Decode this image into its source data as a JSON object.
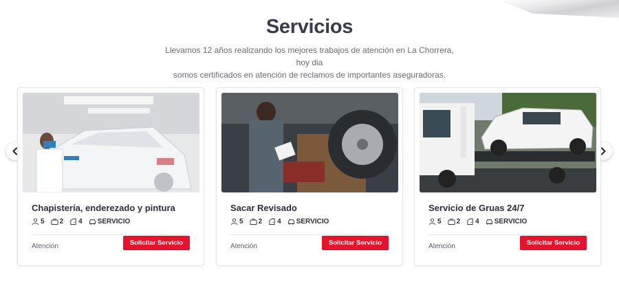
{
  "section": {
    "title": "Servicios",
    "description_line1": "Llevamos 12 años realizando los mejores trabajos de atención en La Chorrera, hoy dia",
    "description_line2": "somos certificados en atención de reclamos de importantes aseguradoras."
  },
  "carousel": {
    "prev_icon": "chevron-left-icon",
    "next_icon": "chevron-right-icon"
  },
  "cards": [
    {
      "title": "Chapistería, enderezado y pintura",
      "image_icon": "car-painting-photo",
      "features": {
        "people": "5",
        "bags": "2",
        "doors": "4",
        "type": "SERVICIO"
      },
      "footer_label": "Atención",
      "button_label": "Solicitar Servicio"
    },
    {
      "title": "Sacar Revisado",
      "image_icon": "mechanic-inspection-photo",
      "features": {
        "people": "5",
        "bags": "2",
        "doors": "4",
        "type": "SERVICIO"
      },
      "footer_label": "Atención",
      "button_label": "Solicitar Servicio"
    },
    {
      "title": "Servicio de Gruas 24/7",
      "image_icon": "tow-truck-photo",
      "features": {
        "people": "5",
        "bags": "2",
        "doors": "4",
        "type": "SERVICIO"
      },
      "footer_label": "Atención",
      "button_label": "Solicitar Servicio"
    }
  ],
  "colors": {
    "accent": "#e8122a",
    "title": "#3b3b4d",
    "text": "#6b6b73"
  }
}
